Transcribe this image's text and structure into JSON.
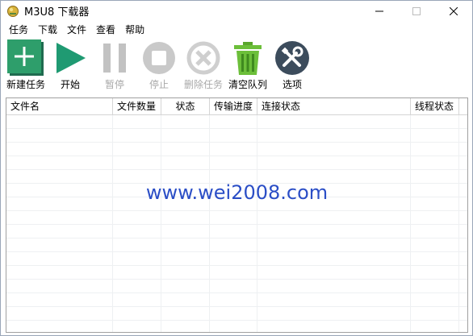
{
  "window": {
    "title": "M3U8 下载器"
  },
  "menu": [
    "任务",
    "下载",
    "文件",
    "查看",
    "帮助"
  ],
  "toolbar": {
    "new_task": "新建任务",
    "start": "开始",
    "pause": "暂停",
    "stop": "停止",
    "delete_task": "删除任务",
    "clear_queue": "清空队列",
    "options": "选项"
  },
  "table": {
    "columns": [
      "文件名",
      "文件数量",
      "状态",
      "传输进度",
      "连接状态",
      "线程状态"
    ]
  },
  "watermark": "www.wei2008.com",
  "colors": {
    "accent_green": "#2e9e6b",
    "watermark_blue": "#2b4ec6",
    "disabled_gray": "#c2c2c2"
  }
}
